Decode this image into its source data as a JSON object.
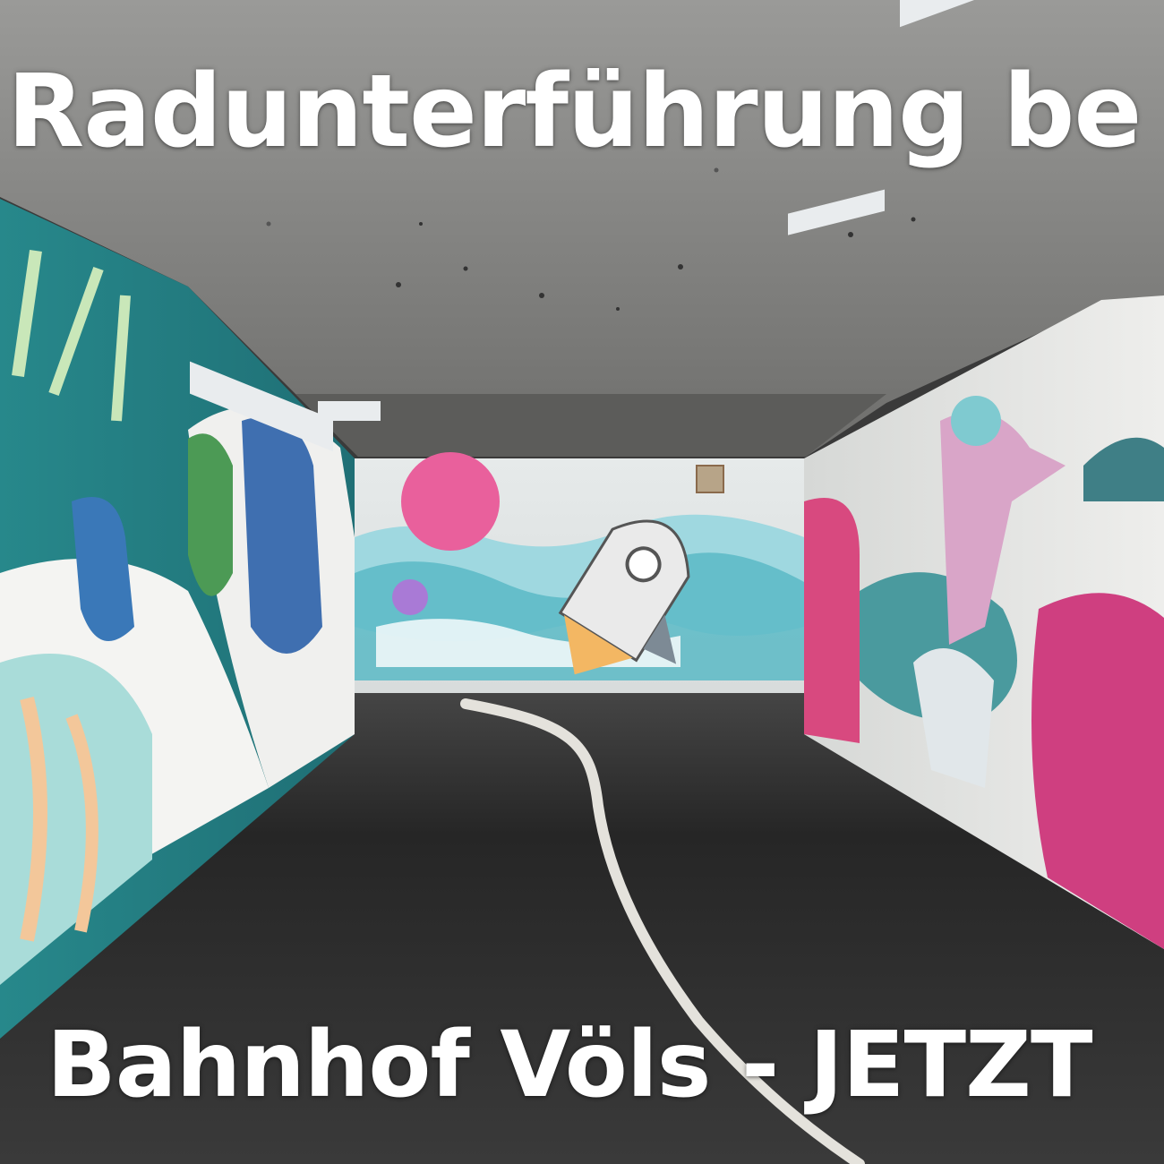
{
  "captions": {
    "top": "Radunterführung be",
    "bottom": "Bahnhof Völs - JETZT"
  },
  "colors": {
    "ceiling": "#8f8f8d",
    "left_wall_teal": "#2f8f93",
    "right_wall_white": "#e8e8e6",
    "mural_pink": "#e5457f",
    "mural_sky": "#9fd8e0",
    "road": "#2e2e2e",
    "lane_line": "#e4e2dc"
  }
}
